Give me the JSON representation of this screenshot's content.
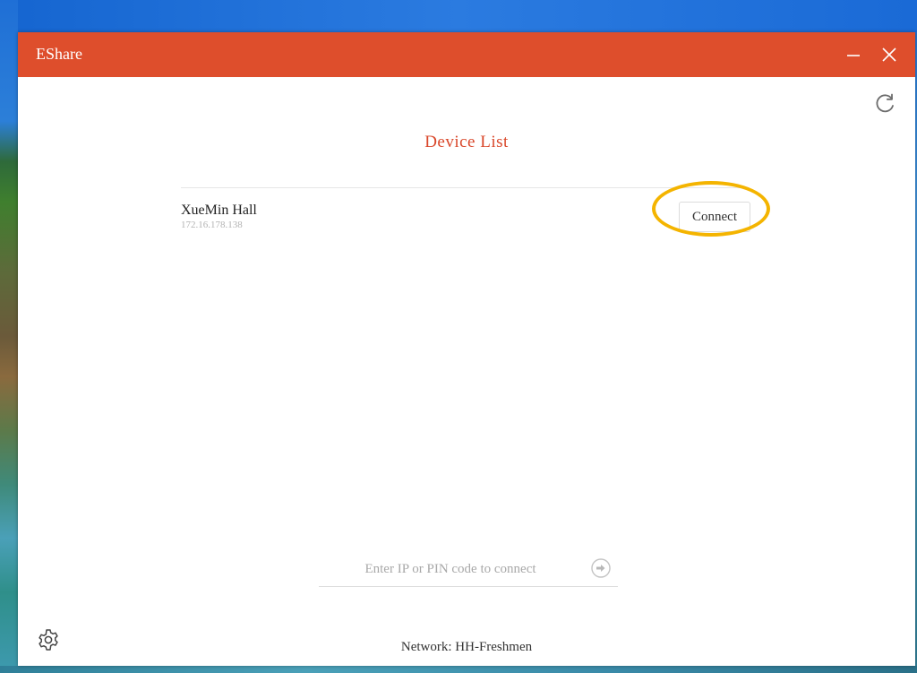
{
  "window": {
    "title": "EShare",
    "minimize_icon": "minimize-icon",
    "close_icon": "close-icon"
  },
  "toolbar": {
    "refresh_icon": "refresh-icon"
  },
  "device_list": {
    "title": "Device List",
    "devices": [
      {
        "name": "XueMin Hall",
        "ip": "172.16.178.138",
        "action_label": "Connect"
      }
    ]
  },
  "connect_bar": {
    "placeholder": "Enter IP or PIN code to connect",
    "value": "",
    "go_icon": "arrow-right-circle-icon"
  },
  "footer": {
    "settings_icon": "gear-icon",
    "network_text": "Network: HH-Freshmen"
  },
  "colors": {
    "accent": "#de4e2c",
    "title_text": "#d9472a",
    "highlight": "#f4b400"
  }
}
